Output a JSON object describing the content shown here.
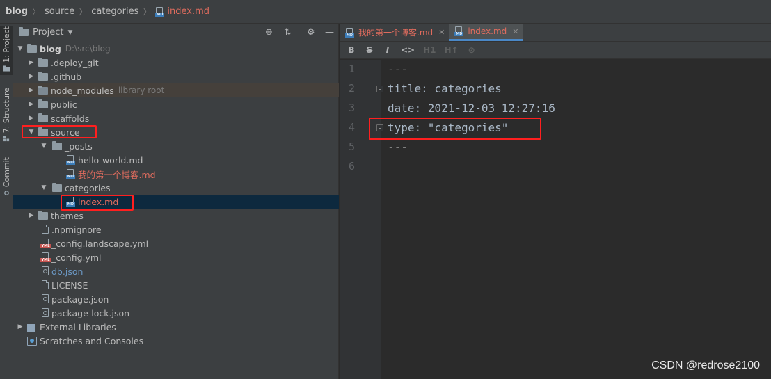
{
  "breadcrumb": {
    "root": "blog",
    "folder1": "source",
    "folder2": "categories",
    "file": "index.md"
  },
  "toolstrip": {
    "project_tab": "1: Project",
    "structure_tab": "7: Structure",
    "commit_tab": "Commit"
  },
  "project_panel": {
    "title": "Project",
    "tree": [
      {
        "label": "blog",
        "hint": "D:\\src\\blog"
      },
      {
        "label": ".deploy_git"
      },
      {
        "label": ".github"
      },
      {
        "label": "node_modules",
        "hint": "library root"
      },
      {
        "label": "public"
      },
      {
        "label": "scaffolds"
      },
      {
        "label": "source"
      },
      {
        "label": "_posts"
      },
      {
        "label": "hello-world.md"
      },
      {
        "label": "我的第一个博客.md"
      },
      {
        "label": "categories"
      },
      {
        "label": "index.md"
      },
      {
        "label": "themes"
      },
      {
        "label": ".npmignore"
      },
      {
        "label": "_config.landscape.yml"
      },
      {
        "label": "_config.yml"
      },
      {
        "label": "db.json"
      },
      {
        "label": "LICENSE"
      },
      {
        "label": "package.json"
      },
      {
        "label": "package-lock.json"
      },
      {
        "label": "External Libraries"
      },
      {
        "label": "Scratches and Consoles"
      }
    ]
  },
  "tabs": [
    {
      "label": "我的第一个博客.md"
    },
    {
      "label": "index.md"
    }
  ],
  "md_toolbar": {
    "bold": "B",
    "strike": "S",
    "italic": "I",
    "code": "<>",
    "h1": "H1",
    "h2": "H↑",
    "link": "⊘"
  },
  "editor": {
    "line_numbers": [
      "1",
      "2",
      "3",
      "4",
      "5",
      "6"
    ],
    "lines": [
      "---",
      "title: categories",
      "date: 2021-12-03 12:27:16",
      "type: \"categories\"",
      "---",
      ""
    ]
  },
  "watermark": "CSDN @redrose2100"
}
